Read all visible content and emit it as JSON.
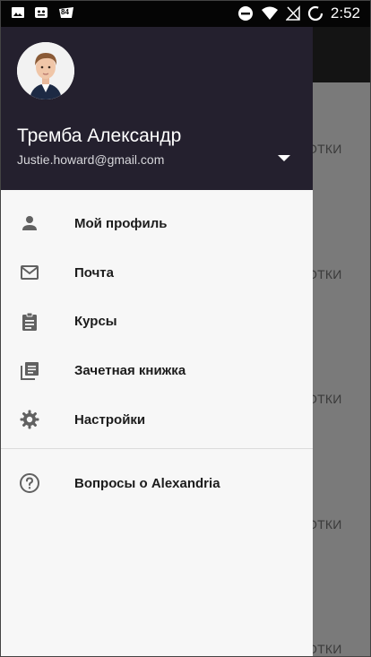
{
  "status_bar": {
    "time": "2:52",
    "notification_badge": "84"
  },
  "user": {
    "name": "Тремба Александр",
    "email": "Justie.howard@gmail.com"
  },
  "menu": [
    {
      "label": "Мой профиль",
      "icon": "person-icon"
    },
    {
      "label": "Почта",
      "icon": "mail-icon"
    },
    {
      "label": "Курсы",
      "icon": "clipboard-icon"
    },
    {
      "label": "Зачетная книжка",
      "icon": "library-books-icon"
    },
    {
      "label": "Настройки",
      "icon": "gear-icon"
    }
  ],
  "help": {
    "label": "Вопросы о Alexandria",
    "icon": "help-icon"
  },
  "background": {
    "partial_label": "ОТКИ"
  },
  "colors": {
    "header": "#24202e",
    "drawer": "#f7f7f7",
    "icon": "#616161",
    "statusbar": "#050505"
  }
}
